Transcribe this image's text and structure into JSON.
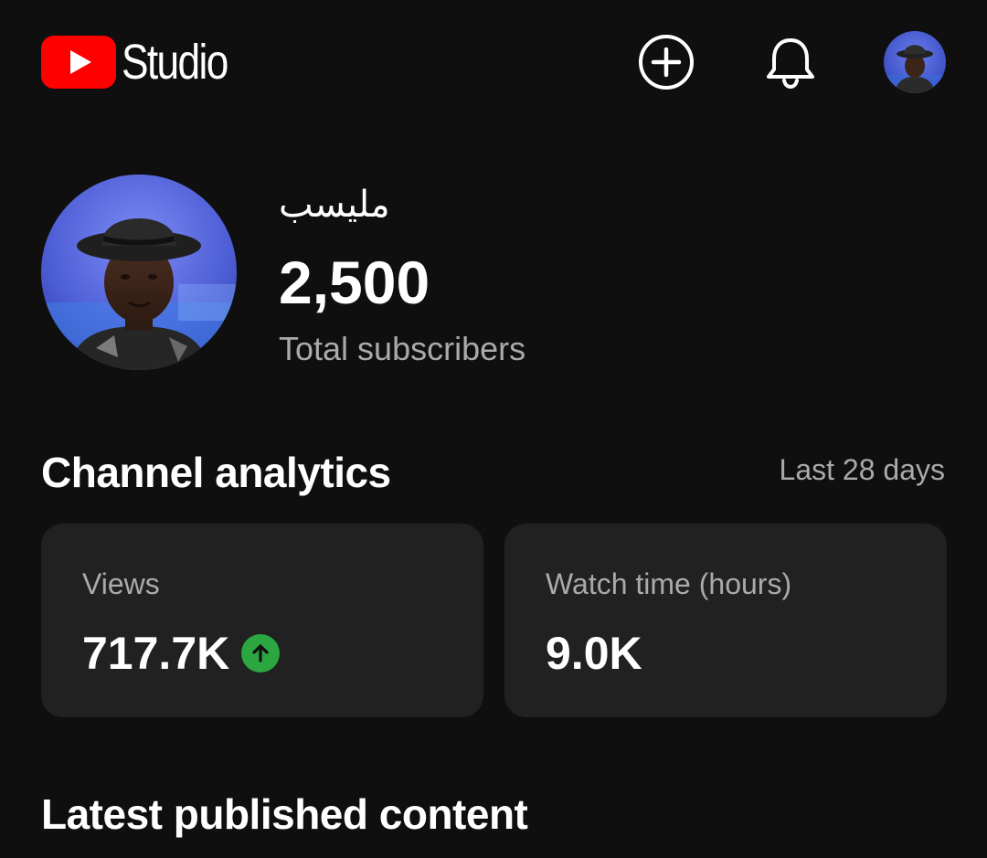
{
  "header": {
    "app_name": "Studio",
    "icons": {
      "create": "create-plus-icon",
      "notifications": "bell-icon",
      "account": "account-avatar"
    },
    "brand_color": "#ff0000"
  },
  "channel": {
    "name": "مليسب",
    "subscriber_count": "2,500",
    "subscriber_label": "Total subscribers"
  },
  "analytics": {
    "title": "Channel analytics",
    "period": "Last 28 days",
    "cards": [
      {
        "label": "Views",
        "value": "717.7K",
        "trend": "up",
        "trend_color": "#2ba640"
      },
      {
        "label": "Watch time (hours)",
        "value": "9.0K"
      }
    ]
  },
  "latest": {
    "title": "Latest published content"
  }
}
